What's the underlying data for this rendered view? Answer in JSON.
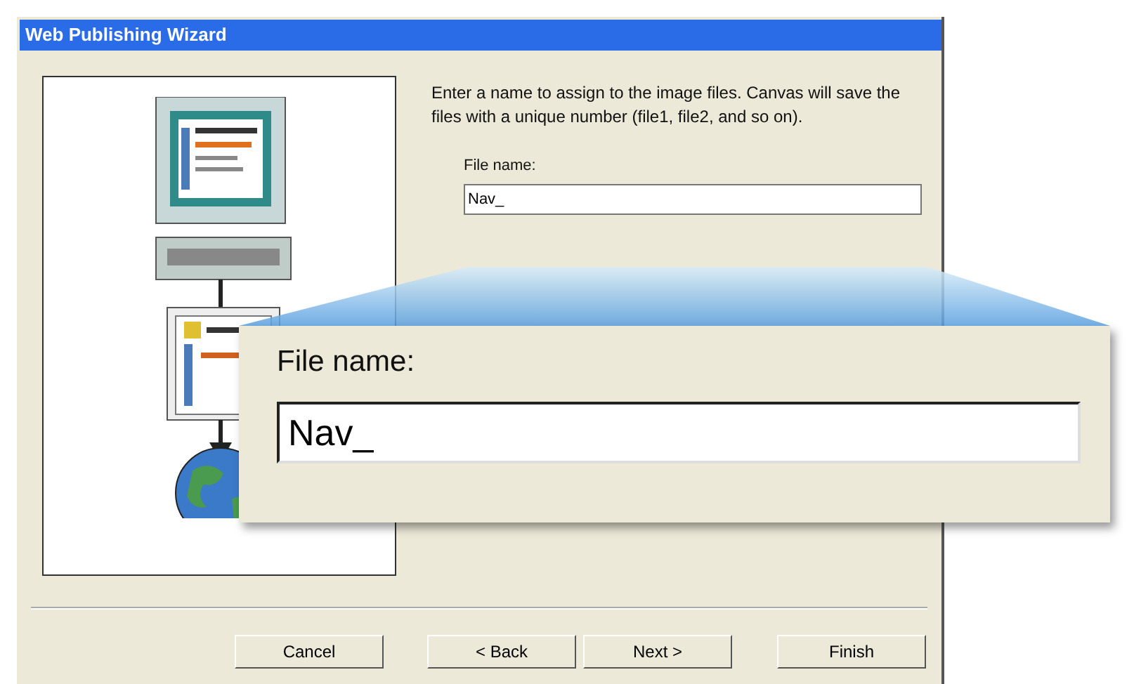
{
  "window": {
    "title": "Web Publishing Wizard"
  },
  "instructions": "Enter a name to assign to the image files. Canvas will save the files with a unique number (file1, file2, and so on).",
  "file_name": {
    "label": "File name:",
    "value": "Nav_"
  },
  "magnifier": {
    "label": "File name:",
    "value": "Nav_"
  },
  "buttons": [
    "Cancel",
    "< Back",
    "Next >",
    "Finish"
  ]
}
